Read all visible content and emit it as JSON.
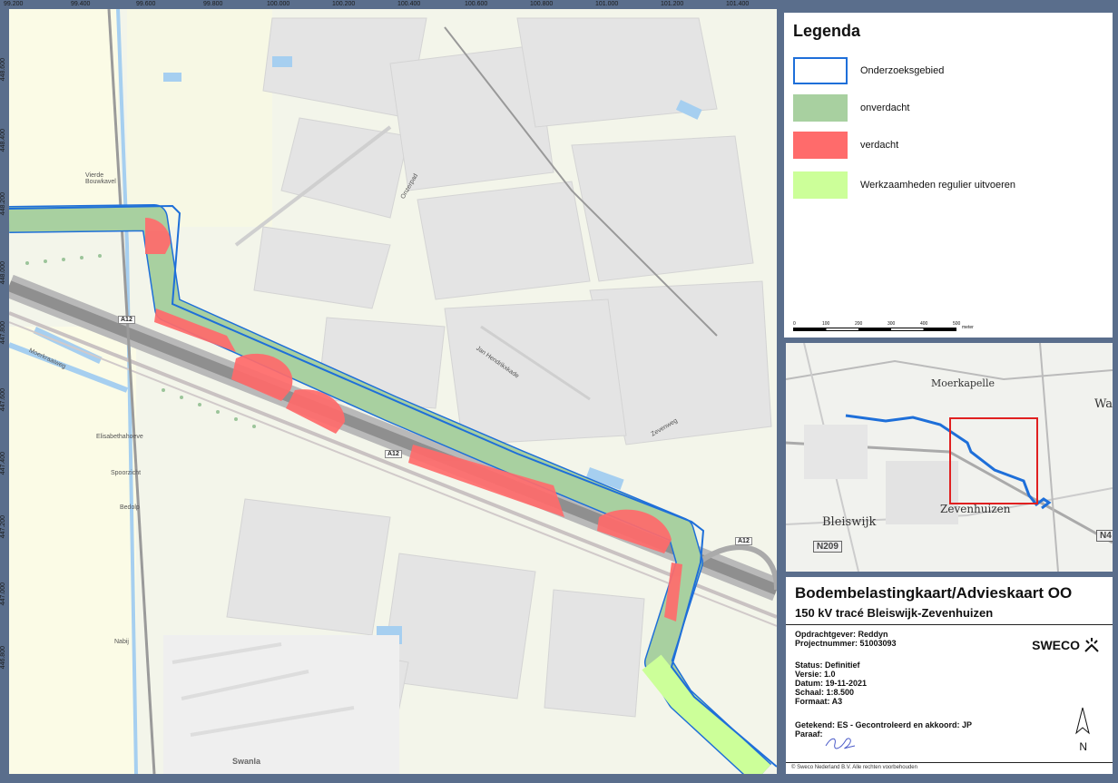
{
  "map": {
    "x_coords": [
      "99.200",
      "99.400",
      "99.600",
      "99.800",
      "100.000",
      "100.200",
      "100.400",
      "100.600",
      "100.800",
      "101.000",
      "101.200",
      "101.400"
    ],
    "y_coords": [
      "448.600",
      "448.400",
      "448.200",
      "448.000",
      "447.800",
      "447.600",
      "447.400",
      "447.200",
      "447.000",
      "446.800"
    ],
    "road_labels": [
      "A12",
      "A12",
      "A12"
    ],
    "place_labels": [
      "Vierde Bouwkavel",
      "Elisabethahoeve",
      "Spoorzicht",
      "Bedolp",
      "Nabij",
      "Swanla"
    ],
    "street_labels": [
      "Onzerpad",
      "Jan Hendrikxkade",
      "Zevenweg",
      "Moerkraaiweg"
    ]
  },
  "legend": {
    "title": "Legenda",
    "items": [
      {
        "label": "Onderzoeksgebied",
        "color": "#ffffff",
        "border": "#1e6fd9"
      },
      {
        "label": "onverdacht",
        "color": "#a8d0a0"
      },
      {
        "label": "verdacht",
        "color": "#ff6b6b"
      },
      {
        "label": "Werkzaamheden regulier uitvoeren",
        "color": "#ccff99"
      }
    ],
    "scale": {
      "ticks": [
        "0",
        "100",
        "200",
        "300",
        "400",
        "500"
      ],
      "unit": "meter"
    }
  },
  "overview": {
    "places": [
      "Moerkapelle",
      "Bleiswijk",
      "Zevenhuizen",
      "Wa"
    ],
    "roads": [
      "N209",
      "N4"
    ]
  },
  "titleblock": {
    "title": "Bodembelastingkaart/Advieskaart OO",
    "subtitle": "150 kV tracé Bleiswijk-Zevenhuizen",
    "client": "Opdrachtgever: Reddyn",
    "project": "Projectnummer: 51003093",
    "status": "Status: Definitief",
    "version": "Versie: 1.0",
    "date": "Datum: 19-11-2021",
    "scale": "Schaal: 1:8.500",
    "format": "Formaat: A3",
    "drawn": "Getekend: ES - Gecontroleerd en akkoord: JP",
    "paraaf": "Paraaf:",
    "company": "SWECO",
    "north": "N",
    "copyright": "© Sweco Nederland B.V.  Alle rechten voorbehouden"
  }
}
